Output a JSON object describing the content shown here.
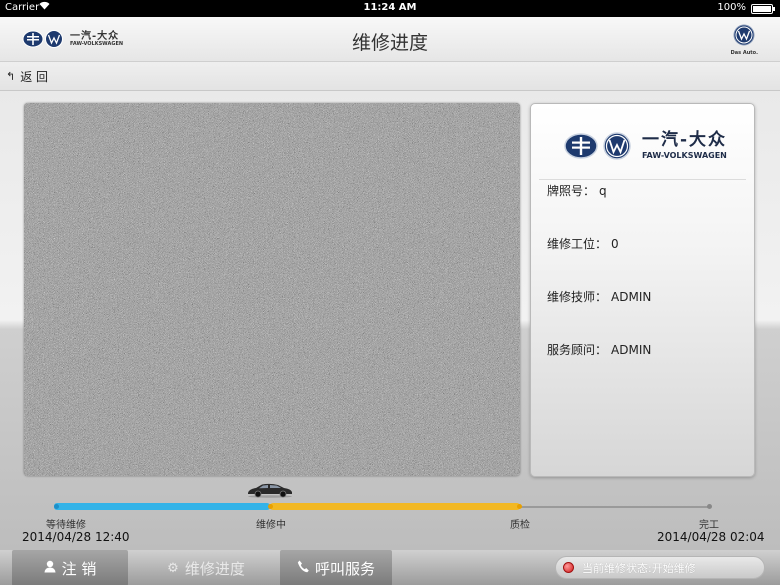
{
  "status_bar": {
    "carrier": "Carrier",
    "time": "11:24 AM",
    "battery": "100%"
  },
  "navbar": {
    "title": "维修进度",
    "brand_cn": "一汽-大众",
    "brand_en": "FAW-VOLKSWAGEN",
    "vw_caption": "Das Auto."
  },
  "backbar": {
    "back_label": "返 回"
  },
  "info_panel": {
    "brand_cn": "一汽-大众",
    "brand_en": "FAW-VOLKSWAGEN",
    "rows": [
      {
        "label": "牌照号：",
        "value": "q"
      },
      {
        "label": "维修工位：",
        "value": "0"
      },
      {
        "label": "维修技师：",
        "value": "ADMIN"
      },
      {
        "label": "服务顾问：",
        "value": "ADMIN"
      }
    ]
  },
  "progress": {
    "stages": [
      {
        "label": "等待维修"
      },
      {
        "label": "维修中"
      },
      {
        "label": "质检"
      },
      {
        "label": "完工"
      }
    ],
    "start_date": "2014/04/28 12:40",
    "end_date": "2014/04/28 02:04",
    "colors": {
      "done": "#33b3e8",
      "current": "#f2b824",
      "pending": "#9a9a9a"
    }
  },
  "tabbar": {
    "logout": "注 销",
    "progress": "维修进度",
    "call": "呼叫服务",
    "status": "当前维修状态:开始维修"
  }
}
